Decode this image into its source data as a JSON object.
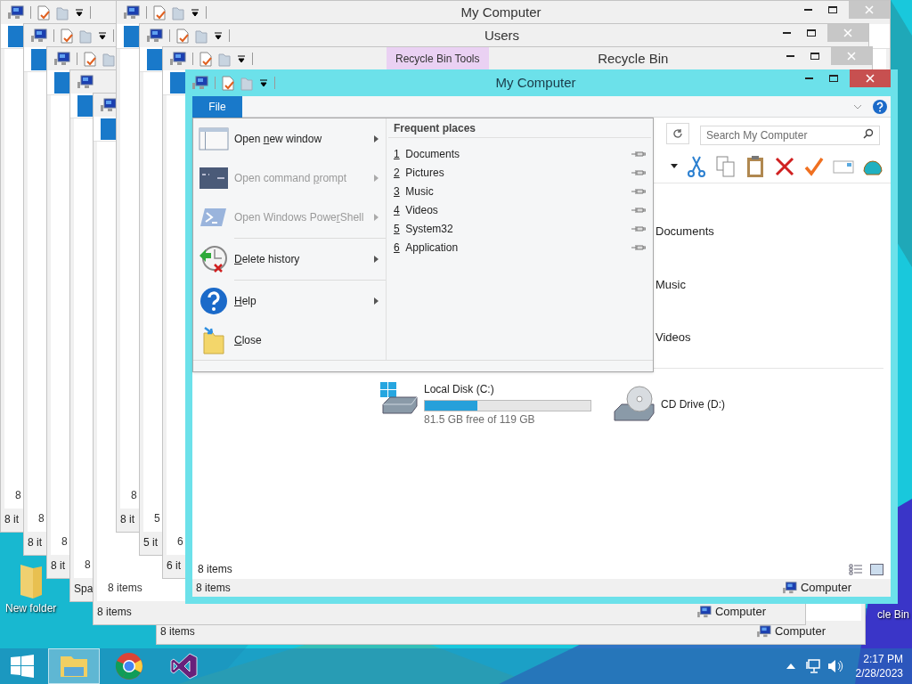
{
  "desktop_icons": [
    {
      "label": "New folder",
      "kind": "folder"
    },
    {
      "label": "cle Bin",
      "kind": "recycle"
    }
  ],
  "windows": [
    {
      "title": "Recycle Bin",
      "tools_tab": "Recycle Bin Tools",
      "content_count": "6",
      "status": "6 it"
    },
    {
      "title": "Users",
      "content_count": "5",
      "status": "5 it"
    },
    {
      "title": "My Computer",
      "content_count": "8",
      "status": "8 it"
    },
    {
      "content_count": "8 items",
      "status": "8 items",
      "status_right": "Computer"
    },
    {
      "status": "8 items",
      "status_right": "Computer"
    },
    {
      "content_count": "8",
      "status": "Spa"
    },
    {
      "content_count": "8",
      "status": "8 it"
    },
    {
      "content_count": "8",
      "status": "8 it"
    },
    {
      "content_count": "8",
      "status": "8 it"
    }
  ],
  "front_window": {
    "title": "My Computer",
    "file_tab": "File",
    "search": {
      "placeholder": "Search My Computer"
    },
    "folders": [
      "Documents",
      "Music",
      "Videos"
    ],
    "drives": [
      {
        "kind": "disk",
        "name": "Local Disk (C:)",
        "level": 0.315,
        "free": "81.5 GB free of 119 GB"
      },
      {
        "kind": "cd",
        "name": "CD Drive (D:)"
      }
    ],
    "content_count": "8 items",
    "status": "8 items",
    "status_right": "Computer"
  },
  "file_menu": {
    "items": [
      {
        "kind": "item",
        "pre": "Open ",
        "key": "n",
        "post": "ew window",
        "disabled": false,
        "submenu": true
      },
      {
        "kind": "item",
        "pre": "Open command ",
        "key": "p",
        "post": "rompt",
        "disabled": true,
        "submenu": true
      },
      {
        "kind": "item",
        "pre": "Open Windows Powe",
        "key": "r",
        "post": "Shell",
        "disabled": true,
        "submenu": true
      },
      {
        "kind": "separator"
      },
      {
        "kind": "item",
        "key": "D",
        "post": "elete history",
        "disabled": false,
        "submenu": true
      },
      {
        "kind": "separator"
      },
      {
        "kind": "item",
        "key": "H",
        "post": "elp",
        "disabled": false,
        "submenu": true
      },
      {
        "kind": "item",
        "key": "C",
        "post": "lose",
        "disabled": false,
        "submenu": false
      }
    ],
    "places_header": "Frequent places",
    "places": [
      {
        "number": "1",
        "label": "Documents"
      },
      {
        "number": "2",
        "label": "Pictures"
      },
      {
        "number": "3",
        "label": "Music"
      },
      {
        "number": "4",
        "label": "Videos"
      },
      {
        "number": "5",
        "label": "System32"
      },
      {
        "number": "6",
        "label": "Application"
      }
    ]
  },
  "taskbar": {
    "apps": [
      {
        "kind": "explorer",
        "selected": true
      },
      {
        "kind": "chrome",
        "selected": false
      },
      {
        "kind": "studio",
        "selected": false
      }
    ],
    "time": "2:17 PM",
    "date": "2/28/2023"
  }
}
